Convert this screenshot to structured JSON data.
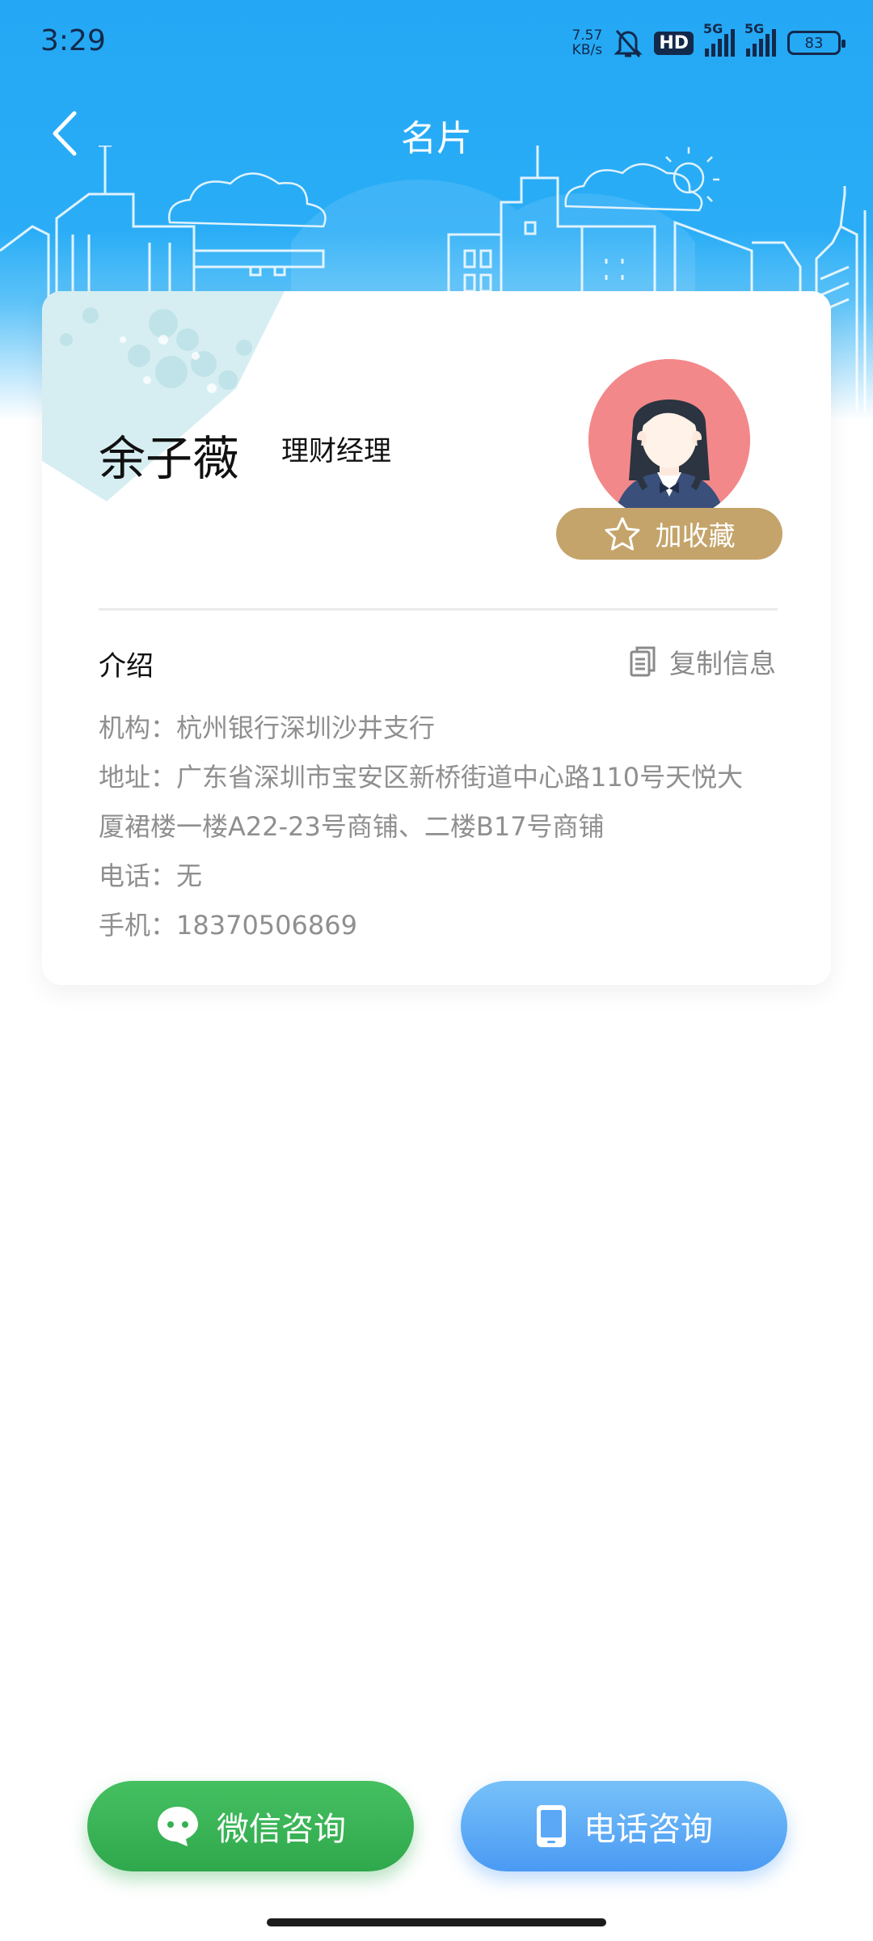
{
  "status_bar": {
    "time": "3:29",
    "net_speed_value": "7.57",
    "net_speed_unit": "KB/s",
    "hd_label": "HD",
    "sim1_label": "5G",
    "sim2_label": "5G",
    "battery": "83"
  },
  "header": {
    "title": "名片",
    "back_icon": "chevron-left-icon"
  },
  "card": {
    "name": "余子薇",
    "job_title": "理财经理",
    "favorite_label": "加收藏",
    "intro_heading": "介绍",
    "copy_label": "复制信息",
    "info": [
      "机构：杭州银行深圳沙井支行",
      "地址：广东省深圳市宝安区新桥街道中心路110号天悦大",
      "厦裙楼一楼A22-23号商铺、二楼B17号商铺",
      "电话：无",
      "手机：18370506869"
    ]
  },
  "actions": {
    "wechat_label": "微信咨询",
    "phone_label": "电话咨询"
  },
  "colors": {
    "header_blue": "#24a8f5",
    "gold": "#c4a46a",
    "wechat_green": "#35b052",
    "phone_blue": "#5aa8f6",
    "muted_text": "#8f8f8f"
  }
}
